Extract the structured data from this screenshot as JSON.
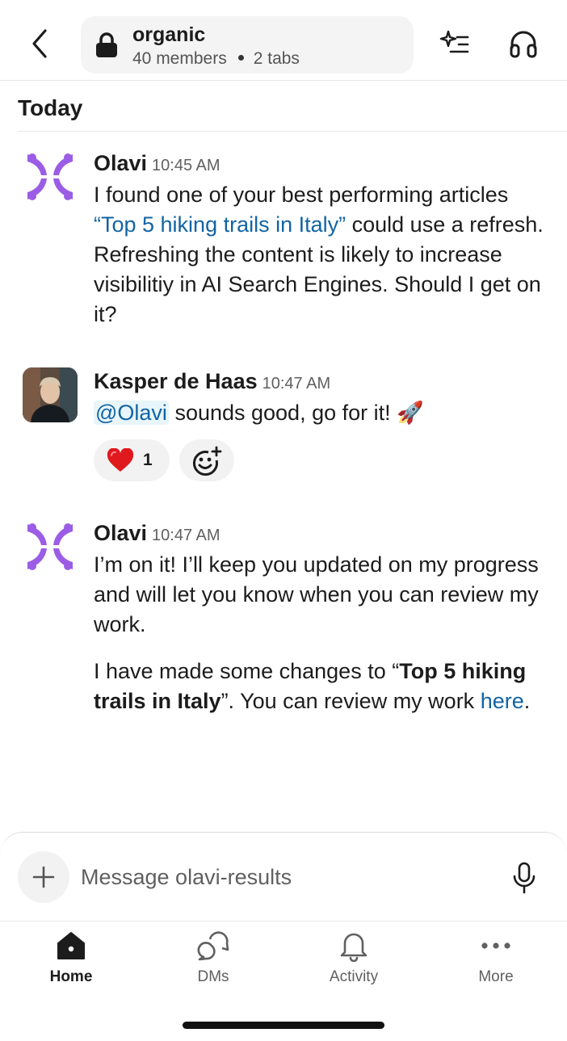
{
  "header": {
    "channel_name": "organic",
    "members": "40 members",
    "tabs": "2 tabs",
    "icons": [
      "chevron-left-icon",
      "lock-icon",
      "sparkle-list-icon",
      "headphones-icon"
    ]
  },
  "section_title": "Today",
  "messages": [
    {
      "author": "Olavi",
      "time": "10:45 AM",
      "avatar": "olavi-logo",
      "text_before": "I found one of your best performing articles ",
      "link_text": "“Top 5 hiking trails in Italy”",
      "text_after": " could use a refresh. Refreshing the content is likely to increase visibilitiy in AI Search Engines. Should I get on it?"
    },
    {
      "author": "Kasper de Haas",
      "time": "10:47 AM",
      "avatar": "user-photo",
      "mention": "@Olavi",
      "text": " sounds good, go for it! 🚀",
      "reactions": [
        {
          "emoji": "heart",
          "count": "1"
        }
      ],
      "add_reaction_icon": "add-emoji-icon"
    },
    {
      "author": "Olavi",
      "time": "10:47 AM",
      "avatar": "olavi-logo",
      "paragraph1": "I’m on it! I’ll keep you updated on my progress and will let you know when you can review my work.",
      "p2_before": "I have made some changes to “",
      "p2_bold": "Top 5 hiking trails in Italy",
      "p2_middle": "”. You can review my work ",
      "p2_link": "here",
      "p2_end": "."
    }
  ],
  "composer": {
    "placeholder": "Message olavi-results",
    "icons": [
      "plus-icon",
      "microphone-icon"
    ]
  },
  "nav": {
    "items": [
      {
        "label": "Home",
        "icon": "home-icon",
        "active": true
      },
      {
        "label": "DMs",
        "icon": "dms-icon",
        "active": false
      },
      {
        "label": "Activity",
        "icon": "bell-icon",
        "active": false
      },
      {
        "label": "More",
        "icon": "more-dots-icon",
        "active": false
      }
    ]
  },
  "colors": {
    "link": "#1264a3",
    "olavi_logo": "#9b5de5",
    "text": "#1d1c1d"
  }
}
